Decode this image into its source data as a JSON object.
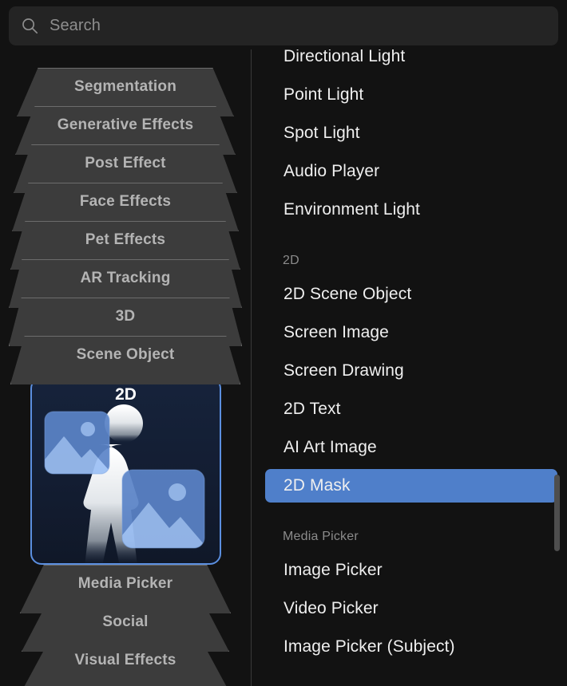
{
  "search": {
    "placeholder": "Search",
    "value": "",
    "icon": "search-icon"
  },
  "sidebar": {
    "items": [
      {
        "label": "Segmentation",
        "selected": false
      },
      {
        "label": "Generative Effects",
        "selected": false
      },
      {
        "label": "Post Effect",
        "selected": false
      },
      {
        "label": "Face Effects",
        "selected": false
      },
      {
        "label": "Pet Effects",
        "selected": false
      },
      {
        "label": "AR Tracking",
        "selected": false
      },
      {
        "label": "3D",
        "selected": false
      },
      {
        "label": "Scene Object",
        "selected": false
      },
      {
        "label": "2D",
        "selected": true
      },
      {
        "label": "Media Picker",
        "selected": false
      },
      {
        "label": "Social",
        "selected": false
      },
      {
        "label": "Visual Effects",
        "selected": false
      }
    ],
    "selected_label": "2D",
    "selected_icon": "person-with-two-images-icon",
    "colors": {
      "tab_fill": "#3c3c3c",
      "tab_border": "#6d6d6d",
      "tab_text": "#b4b4b4",
      "selected_border": "#5b8fe0",
      "selected_fill": "#16233b",
      "selected_text": "#ffffff"
    }
  },
  "list": {
    "sections": [
      {
        "header": null,
        "items": [
          {
            "label": "Directional Light",
            "selected": false
          },
          {
            "label": "Point Light",
            "selected": false
          },
          {
            "label": "Spot Light",
            "selected": false
          },
          {
            "label": "Audio Player",
            "selected": false
          },
          {
            "label": "Environment Light",
            "selected": false
          }
        ]
      },
      {
        "header": "2D",
        "items": [
          {
            "label": "2D Scene Object",
            "selected": false
          },
          {
            "label": "Screen Image",
            "selected": false
          },
          {
            "label": "Screen Drawing",
            "selected": false
          },
          {
            "label": "2D Text",
            "selected": false
          },
          {
            "label": "AI Art Image",
            "selected": false
          },
          {
            "label": "2D Mask",
            "selected": true
          }
        ]
      },
      {
        "header": "Media Picker",
        "items": [
          {
            "label": "Image Picker",
            "selected": false
          },
          {
            "label": "Video Picker",
            "selected": false
          },
          {
            "label": "Image Picker (Subject)",
            "selected": false
          }
        ]
      }
    ],
    "selected_item": "2D Mask",
    "colors": {
      "selection": "#4f7fca",
      "item_text": "#efefef",
      "section_header_text": "#8b8b8b"
    }
  },
  "scrollbar": {
    "orientation": "vertical",
    "thumb_color": "#4e4e4e"
  }
}
